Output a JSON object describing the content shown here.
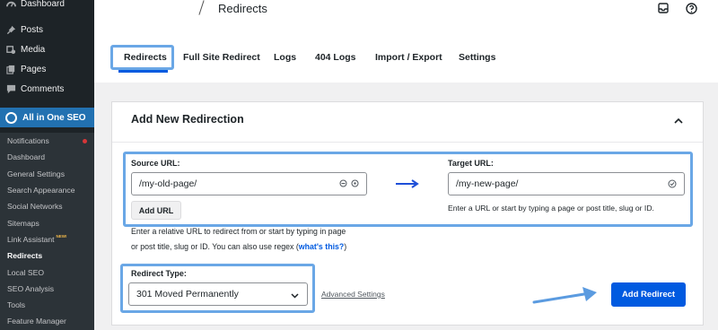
{
  "sidebar": {
    "top_items": [
      {
        "label": "Dashboard",
        "icon": "dashboard-icon"
      },
      {
        "label": "Posts",
        "icon": "pin-icon"
      },
      {
        "label": "Media",
        "icon": "media-icon"
      },
      {
        "label": "Pages",
        "icon": "pages-icon"
      },
      {
        "label": "Comments",
        "icon": "comments-icon"
      }
    ],
    "plugin_label": "All in One SEO",
    "sub_items": [
      {
        "label": "Notifications"
      },
      {
        "label": "Dashboard"
      },
      {
        "label": "General Settings"
      },
      {
        "label": "Search Appearance"
      },
      {
        "label": "Social Networks"
      },
      {
        "label": "Sitemaps"
      },
      {
        "label": "Link Assistant",
        "tag": "NEW!"
      },
      {
        "label": "Redirects"
      },
      {
        "label": "Local SEO"
      },
      {
        "label": "SEO Analysis"
      },
      {
        "label": "Tools"
      },
      {
        "label": "Feature Manager"
      }
    ]
  },
  "header": {
    "title": "Redirects"
  },
  "tabs": [
    "Redirects",
    "Full Site Redirect",
    "Logs",
    "404 Logs",
    "Import / Export",
    "Settings"
  ],
  "card": {
    "title": "Add New Redirection",
    "source_label": "Source URL:",
    "source_value": "/my-old-page/",
    "add_url_label": "Add URL",
    "target_label": "Target URL:",
    "target_value": "/my-new-page/",
    "target_help": "Enter a URL or start by typing a page or post title, slug or ID.",
    "source_help_1": "Enter a relative URL to redirect from or start by typing in page",
    "source_help_2": "or post title, slug or ID. You can also use regex (",
    "source_help_link": "what's this?",
    "source_help_3": ")",
    "redirect_type_label": "Redirect Type:",
    "redirect_type_value": "301 Moved Permanently",
    "advanced_label": "Advanced Settings",
    "submit_label": "Add Redirect"
  },
  "colors": {
    "accent": "#005ae0",
    "highlight": "#6aa7e6",
    "sidebar_bg": "#1d2327",
    "plugin_bg": "#2271b1"
  }
}
